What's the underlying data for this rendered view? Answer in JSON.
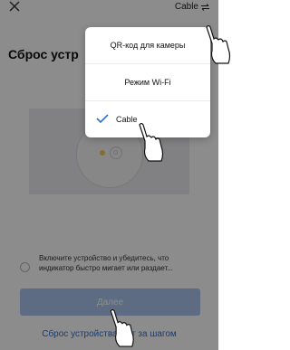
{
  "header": {
    "close_icon": "close-icon",
    "mode_label": "Cable",
    "mode_icon": "swap-arrows-icon"
  },
  "page": {
    "title": "Сброс устр"
  },
  "mode_menu": {
    "items": [
      {
        "label": "QR-код для камеры",
        "selected": false
      },
      {
        "label": "Режим Wi-Fi",
        "selected": false
      },
      {
        "label": "Cable",
        "selected": true
      }
    ],
    "selected_icon": "checkmark-icon"
  },
  "confirm": {
    "text_line1": "Включите устройство и убедитесь, что",
    "text_line2": "индикатор быстро мигает или раздает..."
  },
  "next_button": {
    "label": "Далее"
  },
  "help_link": {
    "label": "Сброс устройства шаг за шагом"
  },
  "colors": {
    "accent": "#2f6fd6",
    "button_disabled": "#a9c5ef",
    "overlay": "rgba(0,0,0,0.45)"
  }
}
